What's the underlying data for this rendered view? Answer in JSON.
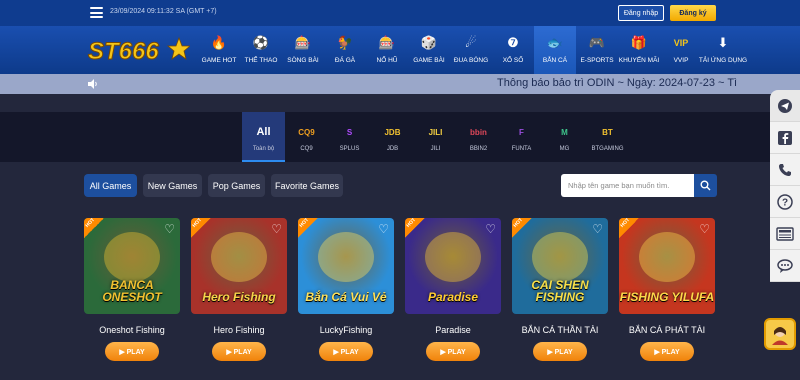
{
  "topbar": {
    "datetime": "23/09/2024 09:11:32 SA (GMT +7)",
    "login_label": "Đăng nhập",
    "register_label": "Đăng ký"
  },
  "logo": {
    "text": "ST666"
  },
  "nav": {
    "items": [
      {
        "label": "GAME HOT",
        "icon": "flame-icon",
        "glyph": "🔥",
        "active": false
      },
      {
        "label": "THỂ THAO",
        "icon": "soccer-ball-icon",
        "glyph": "⚽",
        "active": false
      },
      {
        "label": "SÒNG BÀI",
        "icon": "casino-icon",
        "glyph": "🎰",
        "active": false
      },
      {
        "label": "ĐÁ GÀ",
        "icon": "rooster-icon",
        "glyph": "🐓",
        "active": false
      },
      {
        "label": "NỔ HŨ",
        "icon": "slot-machine-icon",
        "glyph": "🎰",
        "active": false
      },
      {
        "label": "GAME BÀI",
        "icon": "dice-icon",
        "glyph": "🎲",
        "active": false
      },
      {
        "label": "ĐUA BÓNG",
        "icon": "racing-ball-icon",
        "glyph": "☄",
        "active": false
      },
      {
        "label": "XỔ SỐ",
        "icon": "lottery-ball-icon",
        "glyph": "❼",
        "active": false
      },
      {
        "label": "BẮN CÁ",
        "icon": "fish-icon",
        "glyph": "🐟",
        "active": true
      },
      {
        "label": "E-SPORTS",
        "icon": "gamepad-icon",
        "glyph": "🎮",
        "active": false
      },
      {
        "label": "KHUYẾN MÃI",
        "icon": "gift-icon",
        "glyph": "🎁",
        "active": false
      },
      {
        "label": "VVIP",
        "icon": "vip-icon",
        "glyph": "VIP",
        "active": false
      },
      {
        "label": "TẢI ỨNG DỤNG",
        "icon": "download-icon",
        "glyph": "⬇",
        "active": false
      }
    ]
  },
  "marquee": {
    "text": "Thông báo bảo trì ODIN ~ Ngày: 2024-07-23 ~ Tì"
  },
  "providers": [
    {
      "label": "Toàn bộ",
      "logo": "All",
      "color": "#ffffff",
      "active": true
    },
    {
      "label": "CQ9",
      "logo": "CQ9",
      "color": "#f0a020",
      "active": false
    },
    {
      "label": "SPLUS",
      "logo": "S",
      "color": "#b04cff",
      "active": false
    },
    {
      "label": "JDB",
      "logo": "JDB",
      "color": "#f2c230",
      "active": false
    },
    {
      "label": "JILI",
      "logo": "JILI",
      "color": "#f5d142",
      "active": false
    },
    {
      "label": "BBIN2",
      "logo": "bbin",
      "color": "#e0485a",
      "active": false
    },
    {
      "label": "FUNTA",
      "logo": "F",
      "color": "#9b4ee0",
      "active": false
    },
    {
      "label": "MG",
      "logo": "M",
      "color": "#3ec48a",
      "active": false
    },
    {
      "label": "BTGAMING",
      "logo": "BT",
      "color": "#f2c230",
      "active": false
    }
  ],
  "filters": [
    {
      "label": "All Games",
      "active": true
    },
    {
      "label": "New Games",
      "active": false
    },
    {
      "label": "Pop Games",
      "active": false
    },
    {
      "label": "Favorite Games",
      "active": false
    }
  ],
  "search": {
    "placeholder": "Nhập tên game bạn muốn tìm."
  },
  "games": [
    {
      "name": "Oneshot Fishing",
      "art": "BANCA ONESHOT",
      "bg": "#2b6a3a",
      "accent": "#f2c230"
    },
    {
      "name": "Hero Fishing",
      "art": "Hero Fishing",
      "bg": "#a8322a",
      "accent": "#f7d54a"
    },
    {
      "name": "LuckyFishing",
      "art": "Bắn Cá Vui Vẻ",
      "bg": "#2c8fd8",
      "accent": "#ffe15a"
    },
    {
      "name": "Paradise",
      "art": "Paradise",
      "bg": "#3a2a8a",
      "accent": "#ffcc33"
    },
    {
      "name": "BẮN CÁ THẦN TÀI",
      "art": "CAI SHEN FISHING",
      "bg": "#1f6c9c",
      "accent": "#f7e04a"
    },
    {
      "name": "BẮN CÁ PHÁT TÀI",
      "art": "FISHING YILUFA",
      "bg": "#c5361f",
      "accent": "#ffd84a"
    }
  ],
  "play_label": "▶ PLAY",
  "dock": [
    {
      "icon": "telegram-icon"
    },
    {
      "icon": "facebook-icon"
    },
    {
      "icon": "phone-icon"
    },
    {
      "icon": "help-icon"
    },
    {
      "icon": "news-icon"
    },
    {
      "icon": "chat-icon"
    }
  ]
}
